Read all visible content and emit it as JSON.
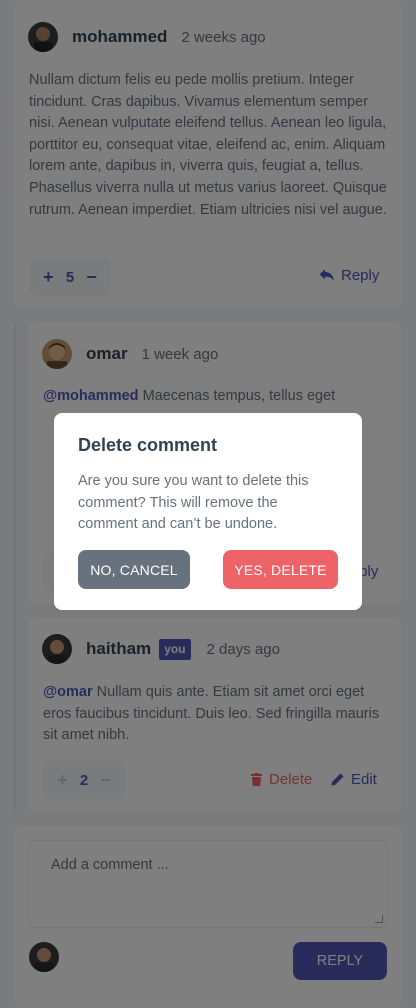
{
  "comment1": {
    "username": "mohammed",
    "time": "2 weeks ago",
    "avatar_icon": "avatar-mohammed",
    "body": "Nullam dictum felis eu pede mollis pretium. Integer tincidunt. Cras dapibus. Vivamus elementum semper nisi. Aenean vulputate eleifend tellus. Aenean leo ligula, porttitor eu, consequat vitae, eleifend ac, enim. Aliquam lorem ante, dapibus in, viverra quis, feugiat a, tellus. Phasellus viverra nulla ut metus varius laoreet. Quisque rutrum. Aenean imperdiet. Etiam ultricies nisi vel augue.",
    "score": "5",
    "reply_label": "Reply"
  },
  "comment2": {
    "username": "omar",
    "time": "1 week ago",
    "mention": "@mohammed",
    "body_visible_line": "Maecenas tempus, tellus eget",
    "reply_label": "Reply"
  },
  "comment3": {
    "username": "haitham",
    "you_badge": "you",
    "time": "2 days ago",
    "mention": "@omar",
    "body": "Nullam quis ante. Etiam sit amet orci eget eros faucibus tincidunt. Duis leo. Sed fringilla mauris sit amet nibh.",
    "score": "2",
    "delete_label": "Delete",
    "edit_label": "Edit"
  },
  "composer": {
    "placeholder": "Add a comment ...",
    "submit_label": "REPLY"
  },
  "modal": {
    "title": "Delete comment",
    "text": "Are you sure you want to delete this comment? This will remove the comment and can’t be undone.",
    "cancel_label": "NO, CANCEL",
    "confirm_label": "YES, DELETE"
  },
  "colors": {
    "accent": "#5357b6",
    "danger": "#ed6368",
    "neutral": "#67727e",
    "heading": "#334253",
    "background": "#f5f6fa"
  }
}
